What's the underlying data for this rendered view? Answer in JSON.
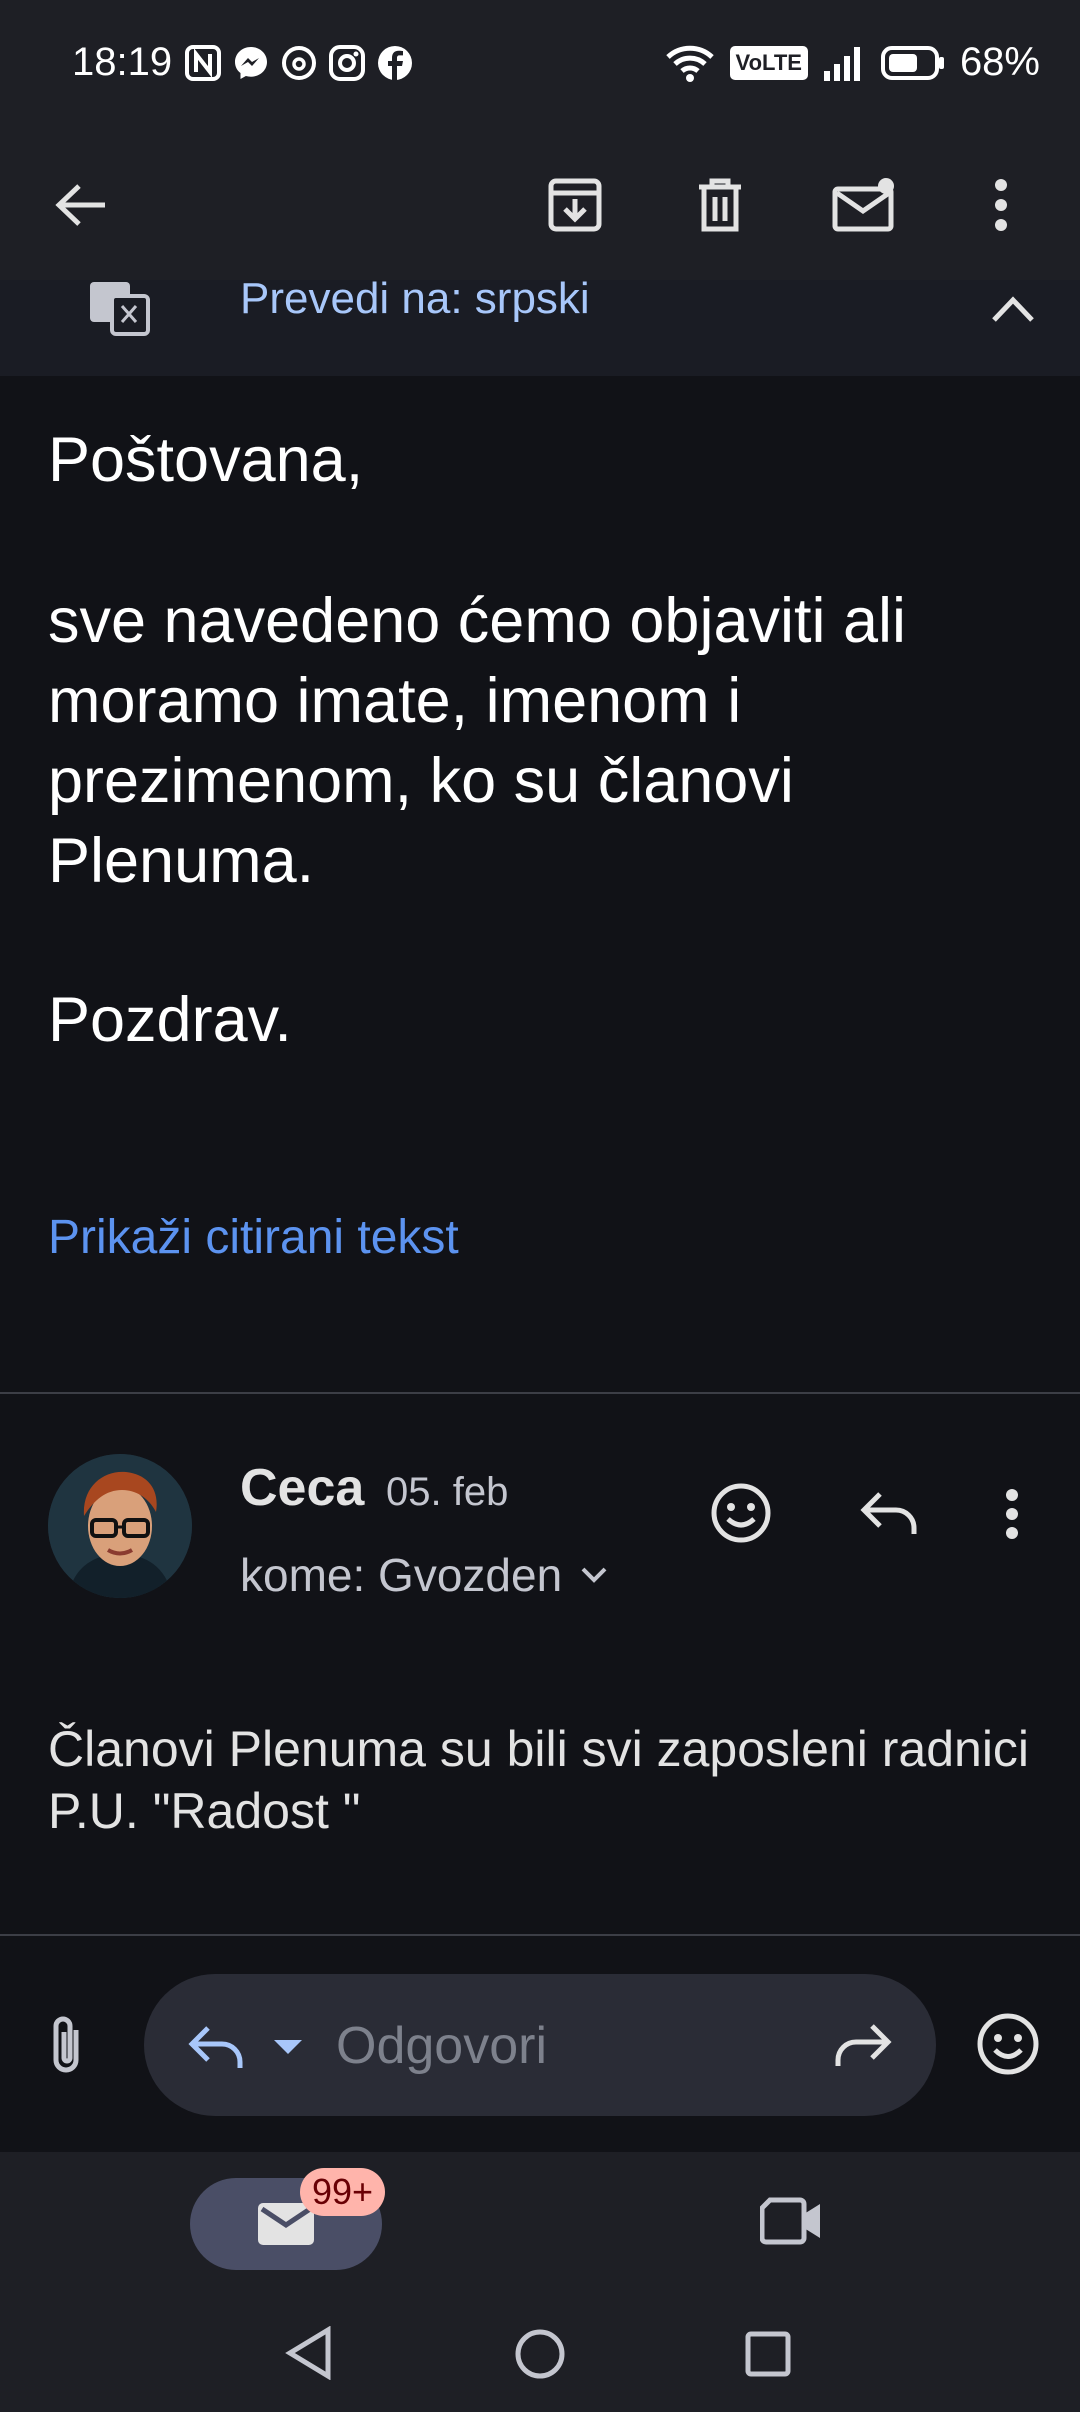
{
  "status_bar": {
    "time": "18:19",
    "battery": "68%",
    "network_badge": "VoLTE"
  },
  "toolbar": {
    "icons": [
      "back-arrow-icon",
      "archive-icon",
      "delete-icon",
      "mark-unread-icon",
      "more-vert-icon"
    ]
  },
  "translate_bar": {
    "label": "Prevedi na: srpski"
  },
  "message1": {
    "greeting": "Poštovana,",
    "paragraph_lines": [
      "sve navedeno ćemo objaviti ali",
      "moramo imate, imenom i",
      "prezimenom, ko su članovi",
      "Plenuma."
    ],
    "closing": "Pozdrav.",
    "show_quoted": "Prikaži citirani tekst"
  },
  "message2": {
    "sender": "Ceca",
    "date": "05. feb",
    "recipient": "kome: Gvozden",
    "body": "Članovi Plenuma su bili svi zaposleni radnici P.U. \"Radost \""
  },
  "reply_bar": {
    "placeholder": "Odgovori"
  },
  "bottom_nav": {
    "mail_badge": "99+"
  },
  "colors": {
    "background": "#111217",
    "surface": "#1e1f25",
    "link": "#5c93f0",
    "badge": "#ffb4ab"
  }
}
